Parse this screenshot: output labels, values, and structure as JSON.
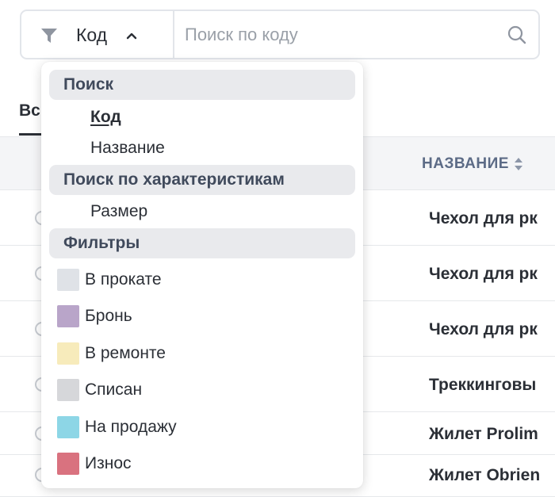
{
  "search": {
    "mode_label": "Код",
    "placeholder": "Поиск по коду",
    "value": ""
  },
  "page": {
    "tab_label": "Вс",
    "column_header": "НАЗВАНИЕ",
    "rows": [
      {
        "name": "Чехол для рк"
      },
      {
        "name": "Чехол для рк"
      },
      {
        "name": "Чехол для рк"
      },
      {
        "name": "Треккинговы"
      },
      {
        "name": "Жилет Prolim"
      },
      {
        "name": "Жилет Obrien"
      }
    ]
  },
  "dropdown": {
    "groups": [
      {
        "label": "Поиск",
        "options": [
          "Код",
          "Название"
        ],
        "selected": "Код"
      },
      {
        "label": "Поиск по характеристикам",
        "options": [
          "Размер"
        ]
      },
      {
        "label": "Фильтры"
      }
    ],
    "statuses": [
      {
        "label": "В прокате",
        "color": "#dfe2e7"
      },
      {
        "label": "Бронь",
        "color": "#b9a5c9"
      },
      {
        "label": "В ремонте",
        "color": "#f7ebbb"
      },
      {
        "label": "Списан",
        "color": "#d6d7da"
      },
      {
        "label": "На продажу",
        "color": "#8dd6e6"
      },
      {
        "label": "Износ",
        "color": "#d9727f"
      }
    ]
  },
  "icons": {
    "filter": "funnel-icon",
    "chevron": "chevron-up-icon",
    "search": "magnifier-icon",
    "sort": "sort-icon"
  }
}
